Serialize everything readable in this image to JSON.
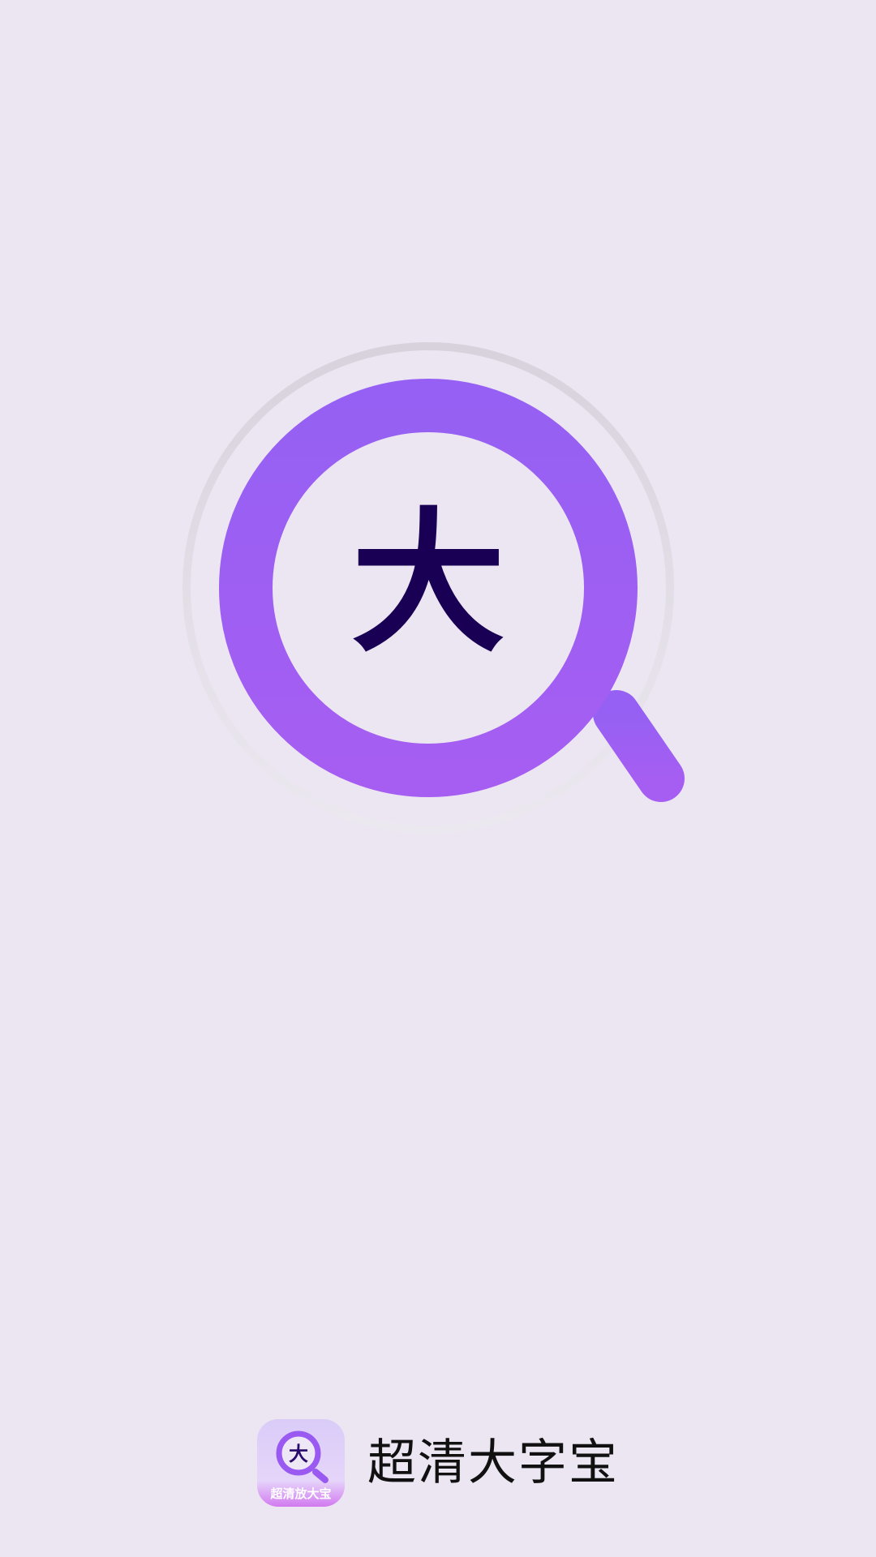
{
  "splash": {
    "hero_char": "大",
    "colors": {
      "background": "#ECE6F2",
      "accent": "#9B5CF3",
      "accent_light": "#A65EF2",
      "char": "#1A0055",
      "halo": "#D9D2DE"
    },
    "icons": [
      "magnifier-icon"
    ]
  },
  "footer": {
    "app_icon_char": "大",
    "app_icon_caption": "超清放大宝",
    "app_name": "超清大字宝"
  }
}
